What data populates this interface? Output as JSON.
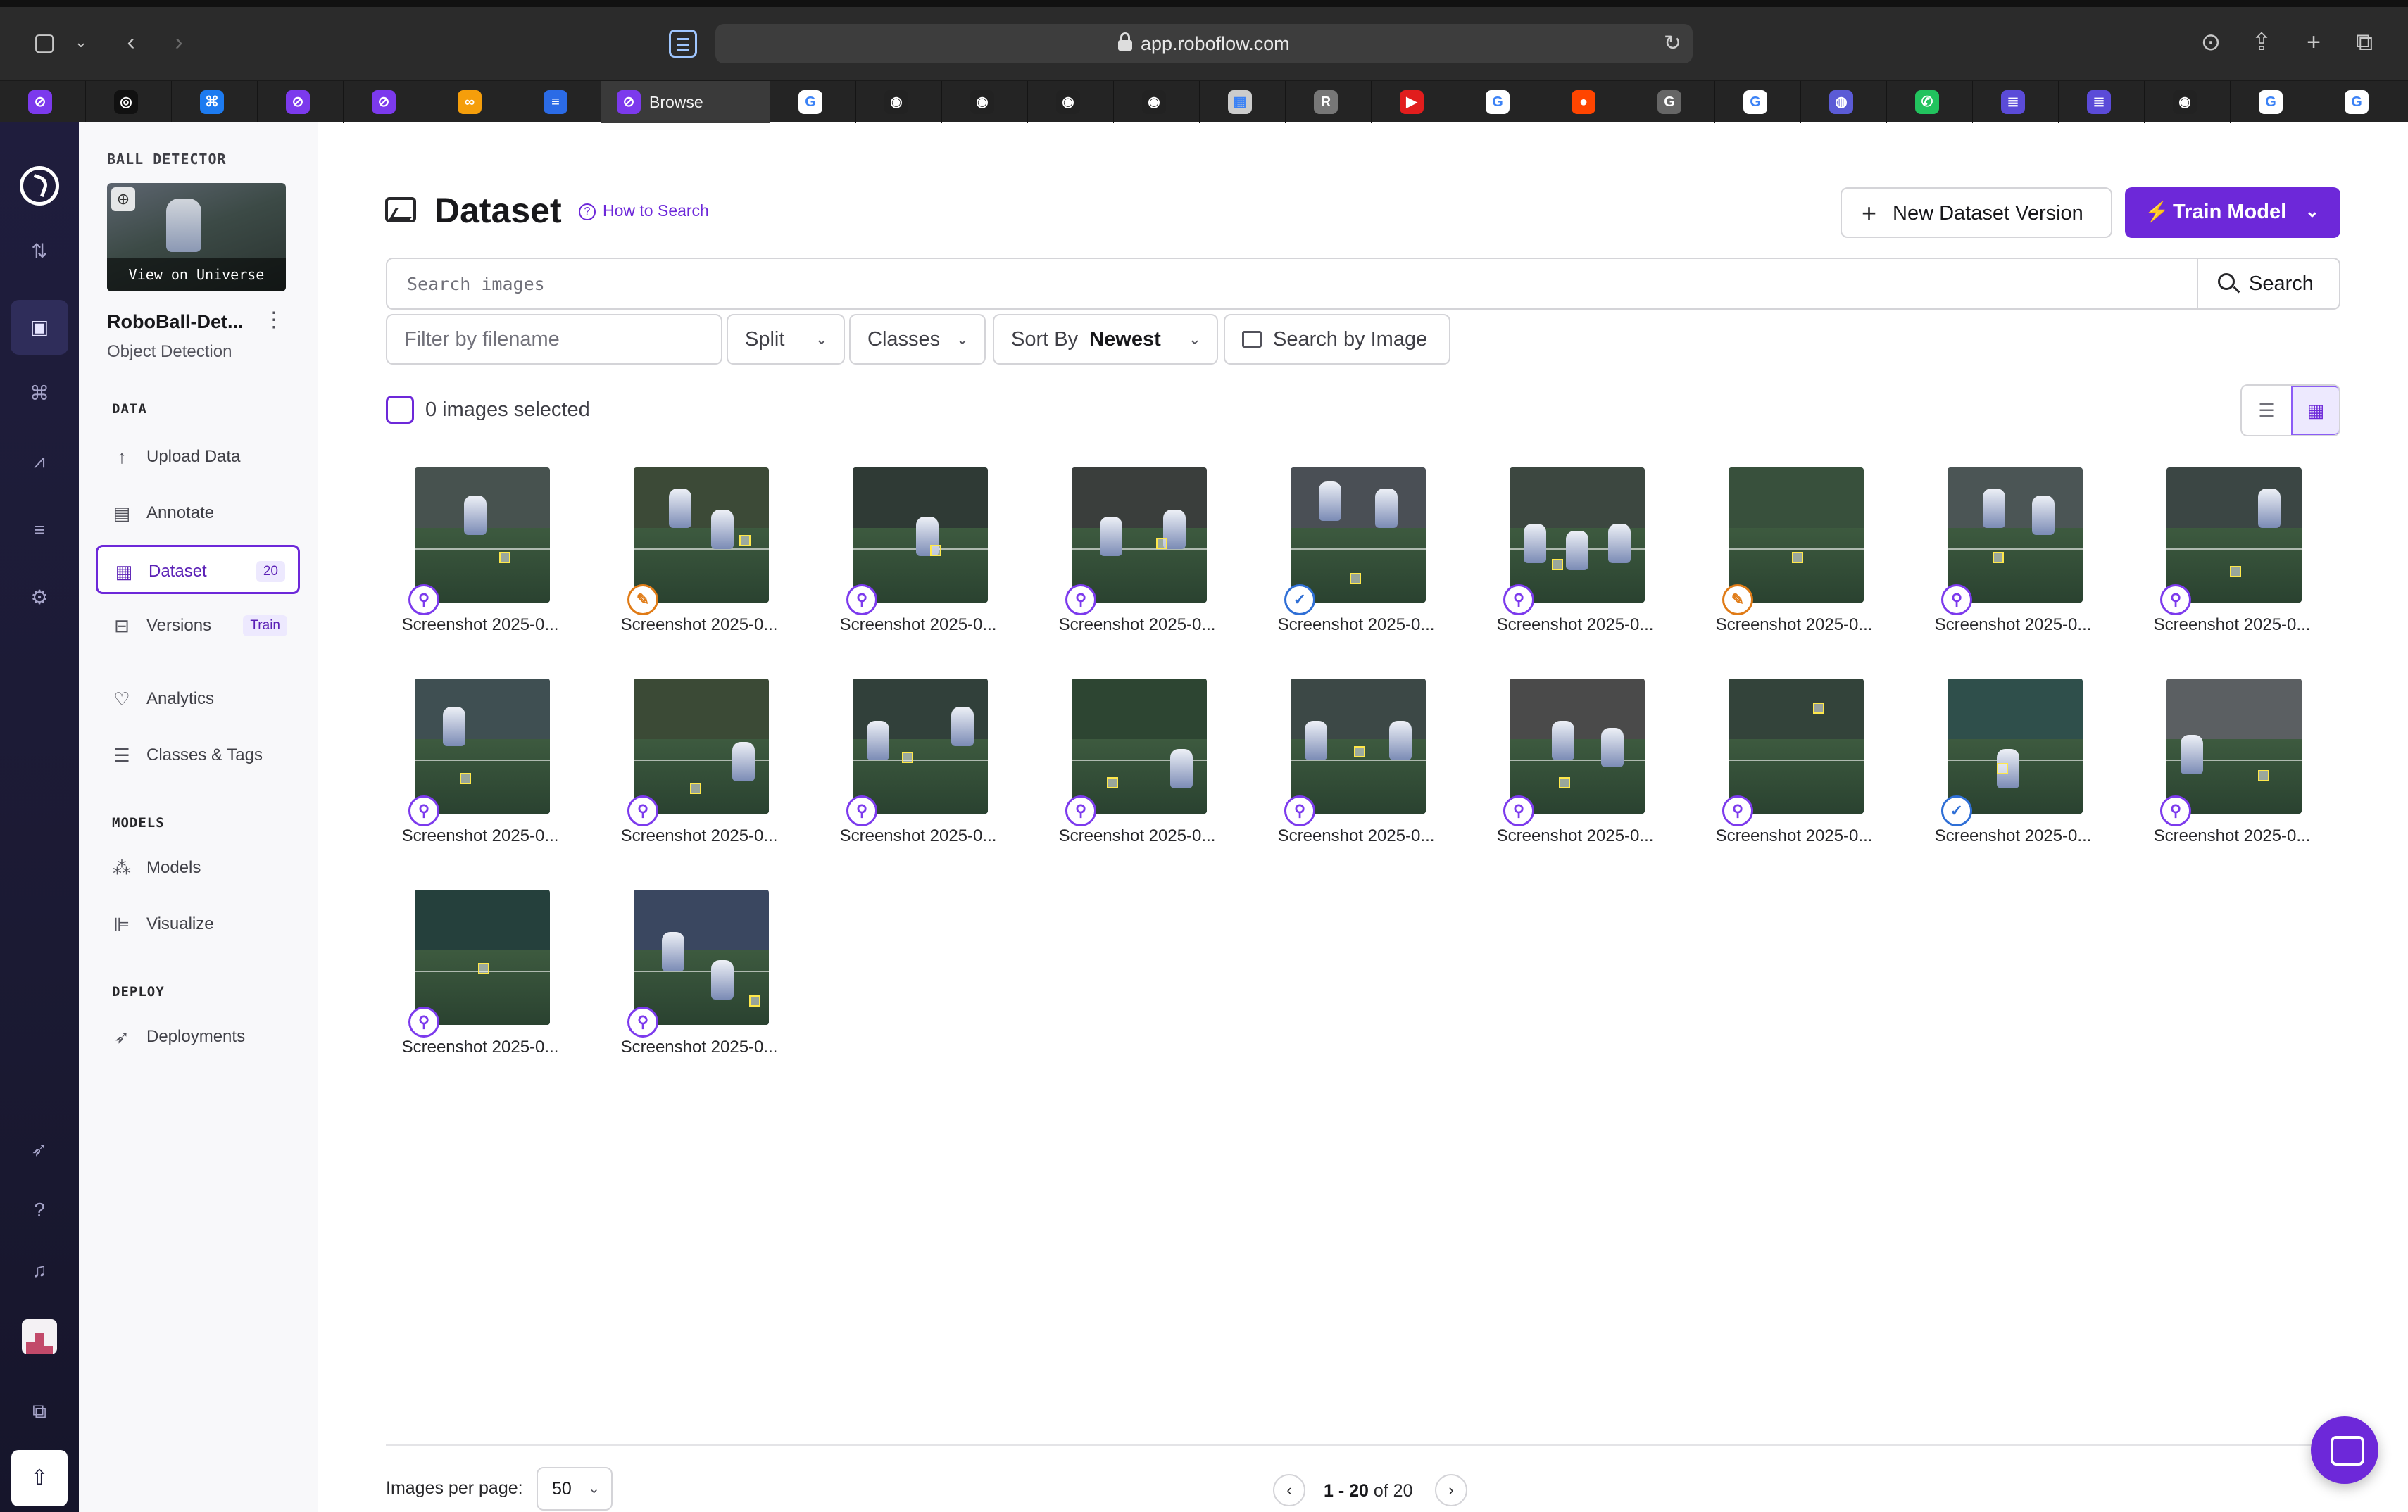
{
  "browser": {
    "url": "app.roboflow.com",
    "active_tab_label": "Browse",
    "tab_favicons": [
      "roboflow",
      "openai",
      "bluesky",
      "roboflow",
      "roboflow",
      "infinity",
      "docs",
      "browse",
      "google",
      "github",
      "github",
      "github",
      "github",
      "image",
      "R",
      "youtube",
      "google",
      "reddit",
      "G",
      "google",
      "circle",
      "whatsapp",
      "notes",
      "notes",
      "github",
      "google",
      "google",
      "google"
    ]
  },
  "project": {
    "kicker": "BALL DETECTOR",
    "view_on_universe": "View on Universe",
    "name": "RoboBall-Det...",
    "type": "Object Detection"
  },
  "nav": {
    "data_section": "DATA",
    "models_section": "MODELS",
    "deploy_section": "DEPLOY",
    "upload": "Upload Data",
    "annotate": "Annotate",
    "dataset": "Dataset",
    "dataset_count": "20",
    "versions": "Versions",
    "versions_badge": "Train",
    "analytics": "Analytics",
    "classes_tags": "Classes & Tags",
    "models": "Models",
    "visualize": "Visualize",
    "deployments": "Deployments"
  },
  "header": {
    "title": "Dataset",
    "how_to_search": "How to Search",
    "new_version": "New Dataset Version",
    "train_model": "Train Model"
  },
  "search": {
    "placeholder": "Search images",
    "button": "Search"
  },
  "filters": {
    "filename_placeholder": "Filter by filename",
    "split": "Split",
    "classes": "Classes",
    "sort_label": "Sort By",
    "sort_value": "Newest",
    "search_by_image": "Search by Image"
  },
  "selection": {
    "count_text": "0 images selected"
  },
  "colors": {
    "accent": "#6d28d9",
    "status_unannotated": "#7c3aed",
    "status_annotated": "#e07b16",
    "status_approved": "#2f6fd6"
  },
  "images": [
    {
      "caption": "Screenshot 2025-0...",
      "status": "unannotated"
    },
    {
      "caption": "Screenshot 2025-0...",
      "status": "annotated"
    },
    {
      "caption": "Screenshot 2025-0...",
      "status": "unannotated"
    },
    {
      "caption": "Screenshot 2025-0...",
      "status": "unannotated"
    },
    {
      "caption": "Screenshot 2025-0...",
      "status": "approved"
    },
    {
      "caption": "Screenshot 2025-0...",
      "status": "unannotated"
    },
    {
      "caption": "Screenshot 2025-0...",
      "status": "annotated"
    },
    {
      "caption": "Screenshot 2025-0...",
      "status": "unannotated"
    },
    {
      "caption": "Screenshot 2025-0...",
      "status": "unannotated"
    },
    {
      "caption": "Screenshot 2025-0...",
      "status": "unannotated"
    },
    {
      "caption": "Screenshot 2025-0...",
      "status": "unannotated"
    },
    {
      "caption": "Screenshot 2025-0...",
      "status": "unannotated"
    },
    {
      "caption": "Screenshot 2025-0...",
      "status": "unannotated"
    },
    {
      "caption": "Screenshot 2025-0...",
      "status": "unannotated"
    },
    {
      "caption": "Screenshot 2025-0...",
      "status": "unannotated"
    },
    {
      "caption": "Screenshot 2025-0...",
      "status": "unannotated"
    },
    {
      "caption": "Screenshot 2025-0...",
      "status": "approved"
    },
    {
      "caption": "Screenshot 2025-0...",
      "status": "unannotated"
    },
    {
      "caption": "Screenshot 2025-0...",
      "status": "unannotated"
    },
    {
      "caption": "Screenshot 2025-0...",
      "status": "unannotated"
    }
  ],
  "footer": {
    "per_page_label": "Images per page:",
    "per_page_value": "50",
    "range": "1 - 20",
    "of_total": "of 20"
  }
}
